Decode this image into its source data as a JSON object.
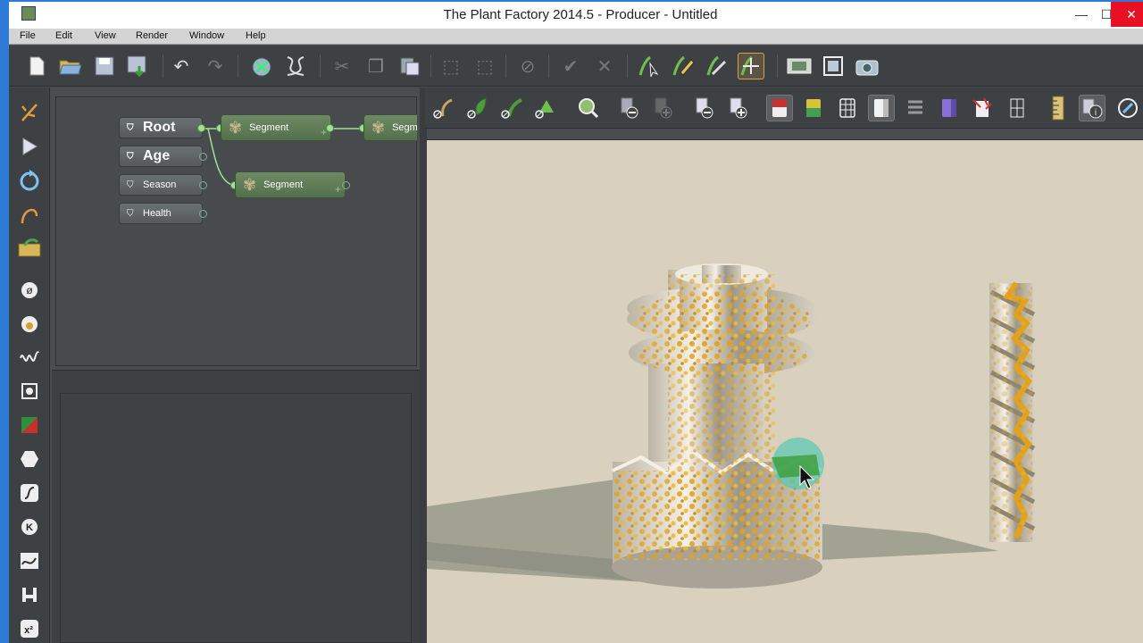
{
  "window": {
    "title": "The Plant Factory 2014.5 - Producer - Untitled",
    "minimize": "—",
    "maximize": "☐",
    "close": "✕"
  },
  "menu": [
    "File",
    "Edit",
    "View",
    "Render",
    "Window",
    "Help"
  ],
  "graph": {
    "inputs": [
      "Root",
      "Age",
      "Season",
      "Health"
    ],
    "segments": [
      "Segment",
      "Segment",
      "Segm"
    ]
  },
  "colors": {
    "titlebar_accent": "#2d7bd6",
    "close_button": "#e81123",
    "viewport_bg": "#d9d1bd",
    "segment_node": "#5f7c57",
    "gold_foliage": "#e3a21a"
  }
}
